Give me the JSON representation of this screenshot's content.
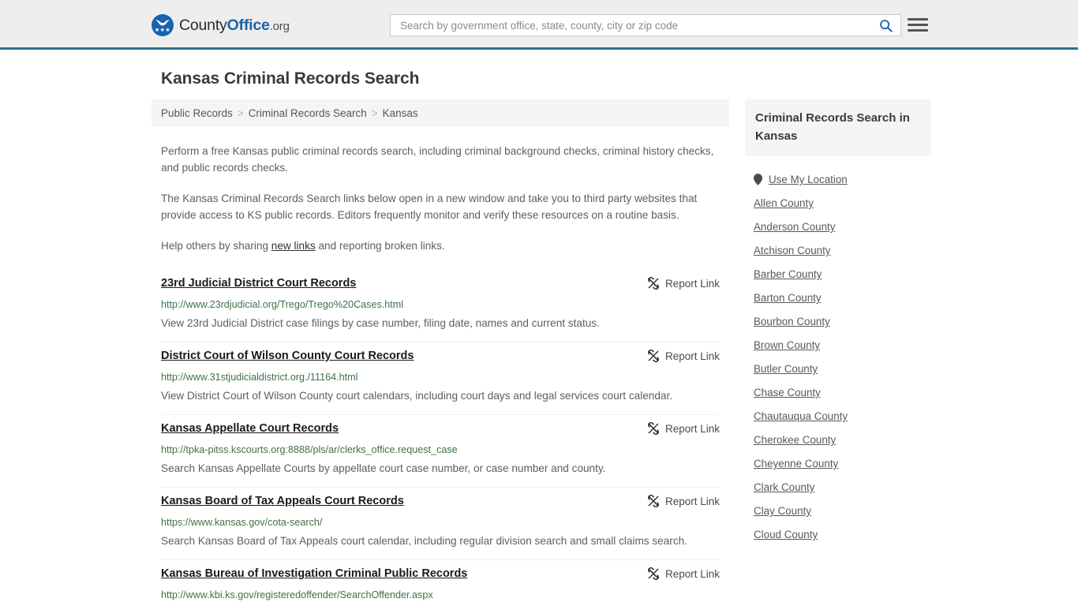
{
  "header": {
    "logo": {
      "part1": "County",
      "part2": "Office",
      "part3": ".org",
      "icon": "eagle-seal-icon",
      "stars": "★★★",
      "color": "#1963ad"
    },
    "search": {
      "placeholder": "Search by government office, state, county, city or zip code",
      "value": "",
      "icon": "search-icon"
    },
    "menu": {
      "icon": "hamburger-menu-icon",
      "label": "Menu"
    },
    "border_color": "#31708f",
    "background": "#eeeeee"
  },
  "page_title": "Kansas Criminal Records Search",
  "breadcrumb": {
    "items": [
      {
        "label": "Public Records",
        "current": false
      },
      {
        "label": "Criminal Records Search",
        "current": false
      },
      {
        "label": "Kansas",
        "current": true
      }
    ],
    "separator": ">"
  },
  "intro": {
    "p1": "Perform a free Kansas public criminal records search, including criminal background checks, criminal history checks, and public records checks.",
    "p2": "The Kansas Criminal Records Search links below open in a new window and take you to third party websites that provide access to KS public records. Editors frequently monitor and verify these resources on a routine basis.",
    "p3_before": "Help others by sharing ",
    "p3_link": "new links",
    "p3_after": " and reporting broken links."
  },
  "report_link_label": "Report Link",
  "report_link_icon": "broken-link-icon",
  "results": [
    {
      "title": "23rd Judicial District Court Records",
      "url": "http://www.23rdjudicial.org/Trego/Trego%20Cases.html",
      "description": "View 23rd Judicial District case filings by case number, filing date, names and current status."
    },
    {
      "title": "District Court of Wilson County Court Records",
      "url": "http://www.31stjudicialdistrict.org./11164.html",
      "description": "View District Court of Wilson County court calendars, including court days and legal services court calendar."
    },
    {
      "title": "Kansas Appellate Court Records",
      "url": "http://tpka-pitss.kscourts.org:8888/pls/ar/clerks_office.request_case",
      "description": "Search Kansas Appellate Courts by appellate court case number, or case number and county."
    },
    {
      "title": "Kansas Board of Tax Appeals Court Records",
      "url": "https://www.kansas.gov/cota-search/",
      "description": "Search Kansas Board of Tax Appeals court calendar, including regular division search and small claims search."
    },
    {
      "title": "Kansas Bureau of Investigation Criminal Public Records",
      "url": "http://www.kbi.ks.gov/registeredoffender/SearchOffender.aspx",
      "description": ""
    }
  ],
  "sidebar": {
    "heading": "Criminal Records Search in Kansas",
    "use_my_location": {
      "label": "Use My Location",
      "icon": "map-pin-icon"
    },
    "counties": [
      "Allen County",
      "Anderson County",
      "Atchison County",
      "Barber County",
      "Barton County",
      "Bourbon County",
      "Brown County",
      "Butler County",
      "Chase County",
      "Chautauqua County",
      "Cherokee County",
      "Cheyenne County",
      "Clark County",
      "Clay County",
      "Cloud County"
    ]
  },
  "colors": {
    "url_green": "#3f7247",
    "brand_blue": "#1963ad",
    "header_rule": "#31708f",
    "body_text": "#5e5e5e"
  }
}
